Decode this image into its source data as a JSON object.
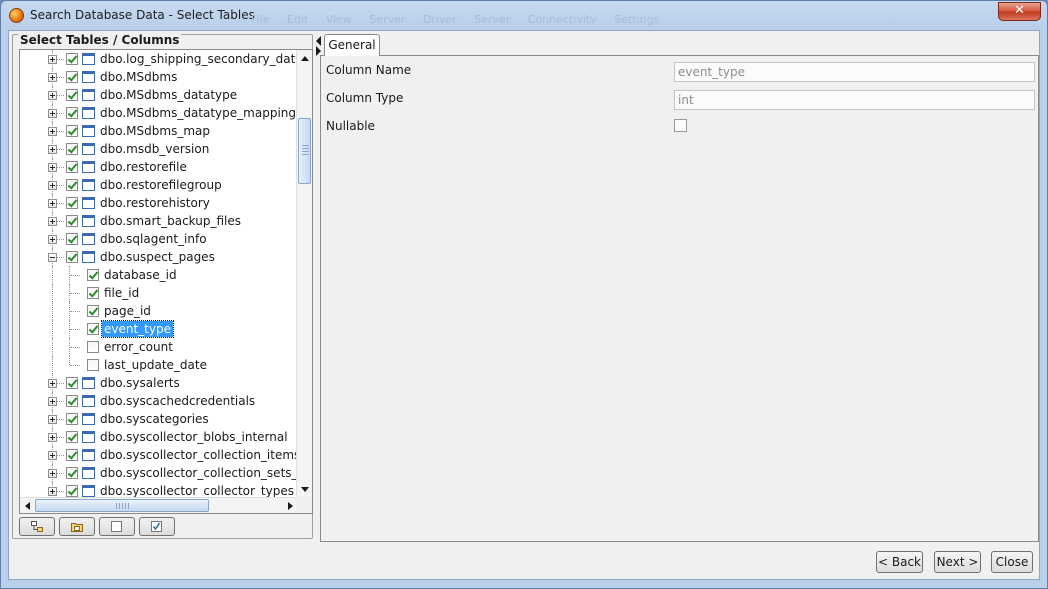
{
  "window": {
    "title": "Search Database Data - Select Tables",
    "close_glyph": "✕"
  },
  "ghost_menu": "File Edit View Server Driver Server Connectivity Settings",
  "left_panel": {
    "group_title": "Select Tables / Columns",
    "tree_items": [
      {
        "label": "dbo.log_shipping_secondary_databases",
        "level": 0,
        "checked": true,
        "expanded": false
      },
      {
        "label": "dbo.MSdbms",
        "level": 0,
        "checked": true,
        "expanded": false
      },
      {
        "label": "dbo.MSdbms_datatype",
        "level": 0,
        "checked": true,
        "expanded": false
      },
      {
        "label": "dbo.MSdbms_datatype_mapping",
        "level": 0,
        "checked": true,
        "expanded": false
      },
      {
        "label": "dbo.MSdbms_map",
        "level": 0,
        "checked": true,
        "expanded": false
      },
      {
        "label": "dbo.msdb_version",
        "level": 0,
        "checked": true,
        "expanded": false
      },
      {
        "label": "dbo.restorefile",
        "level": 0,
        "checked": true,
        "expanded": false
      },
      {
        "label": "dbo.restorefilegroup",
        "level": 0,
        "checked": true,
        "expanded": false
      },
      {
        "label": "dbo.restorehistory",
        "level": 0,
        "checked": true,
        "expanded": false
      },
      {
        "label": "dbo.smart_backup_files",
        "level": 0,
        "checked": true,
        "expanded": false
      },
      {
        "label": "dbo.sqlagent_info",
        "level": 0,
        "checked": true,
        "expanded": false
      },
      {
        "label": "dbo.suspect_pages",
        "level": 0,
        "checked": true,
        "expanded": true
      },
      {
        "label": "database_id",
        "level": 1,
        "checked": true
      },
      {
        "label": "file_id",
        "level": 1,
        "checked": true
      },
      {
        "label": "page_id",
        "level": 1,
        "checked": true
      },
      {
        "label": "event_type",
        "level": 1,
        "checked": true,
        "selected": true
      },
      {
        "label": "error_count",
        "level": 1,
        "checked": false
      },
      {
        "label": "last_update_date",
        "level": 1,
        "checked": false
      },
      {
        "label": "dbo.sysalerts",
        "level": 0,
        "checked": true,
        "expanded": false
      },
      {
        "label": "dbo.syscachedcredentials",
        "level": 0,
        "checked": true,
        "expanded": false
      },
      {
        "label": "dbo.syscategories",
        "level": 0,
        "checked": true,
        "expanded": false
      },
      {
        "label": "dbo.syscollector_blobs_internal",
        "level": 0,
        "checked": true,
        "expanded": false
      },
      {
        "label": "dbo.syscollector_collection_items_internal",
        "level": 0,
        "checked": true,
        "expanded": false
      },
      {
        "label": "dbo.syscollector_collection_sets_internal",
        "level": 0,
        "checked": true,
        "expanded": false
      },
      {
        "label": "dbo.syscollector_collector_types_internal",
        "level": 0,
        "checked": true,
        "expanded": false
      }
    ],
    "toolbar": [
      "expand-all-icon",
      "collapse-all-icon",
      "uncheck-all-icon",
      "check-all-icon"
    ]
  },
  "right_panel": {
    "tab_label": "General",
    "column_name_label": "Column Name",
    "column_name_value": "event_type",
    "column_type_label": "Column Type",
    "column_type_value": "int",
    "nullable_label": "Nullable",
    "nullable_checked": false
  },
  "buttons": {
    "back": "< Back",
    "next": "Next >",
    "close": "Close"
  },
  "colors": {
    "selection": "#3399ff",
    "check": "#2b8a2b",
    "titlebar": "#c6d9f0",
    "close_button": "#c2381c"
  }
}
